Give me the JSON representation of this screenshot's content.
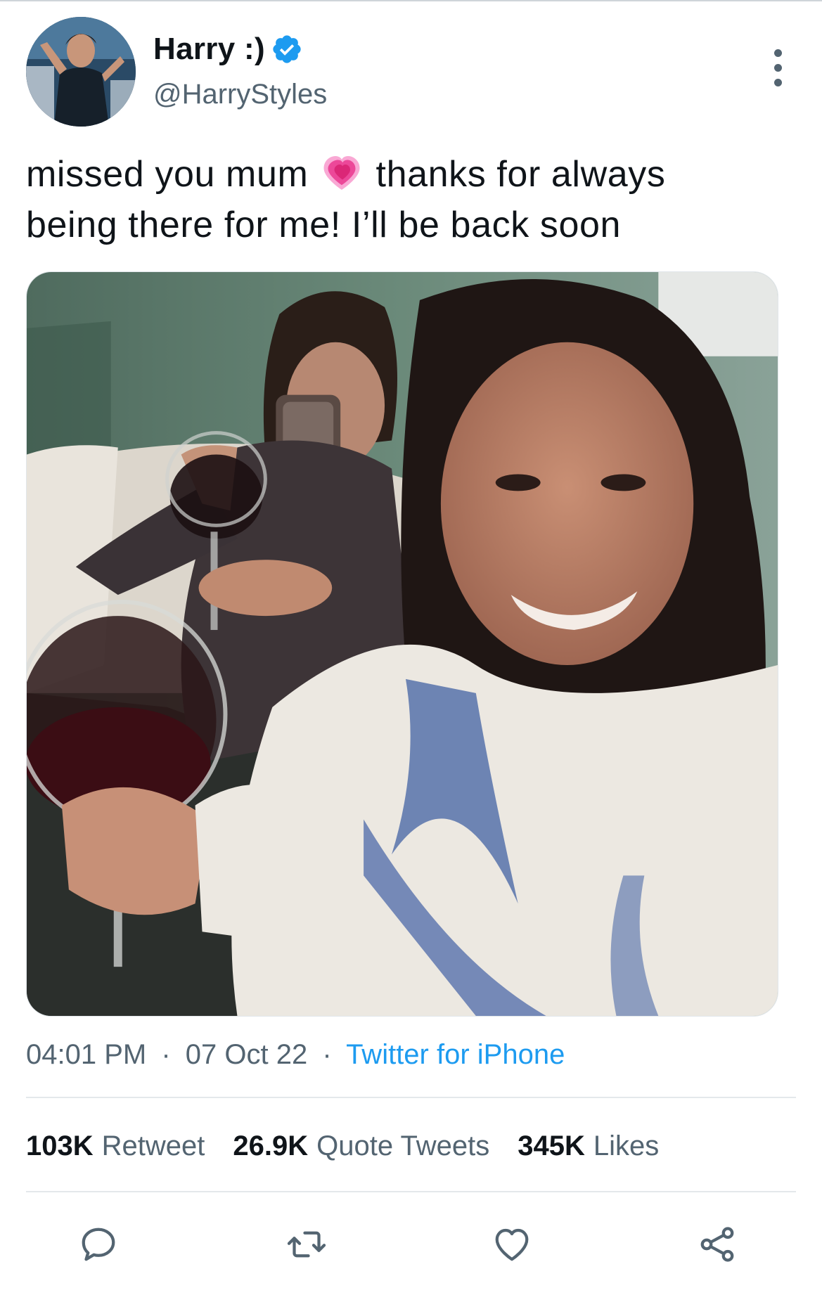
{
  "tweet": {
    "author": {
      "display_name": "Harry :)",
      "handle": "@HarryStyles",
      "verified": true,
      "avatar_icon": "avatar-photo"
    },
    "text_part1": "missed you mum",
    "emoji": "growing-heart-emoji",
    "text_part2": "thanks for always being there for me! I’ll be back soon",
    "media": {
      "type": "photo"
    },
    "time": "04:01 PM",
    "date": "07 Oct 22",
    "separator": "·",
    "source": "Twitter for iPhone"
  },
  "stats": {
    "retweets": {
      "count": "103K",
      "label": "Retweet"
    },
    "quotes": {
      "count": "26.9K",
      "label": "Quote Tweets"
    },
    "likes": {
      "count": "345K",
      "label": "Likes"
    }
  },
  "actions": {
    "reply_icon": "reply-icon",
    "retweet_icon": "retweet-icon",
    "like_icon": "heart-icon",
    "share_icon": "share-icon"
  },
  "colors": {
    "text": "#0f1419",
    "secondary": "#536471",
    "link": "#1d9bf0",
    "divider": "#e4e8eb"
  }
}
